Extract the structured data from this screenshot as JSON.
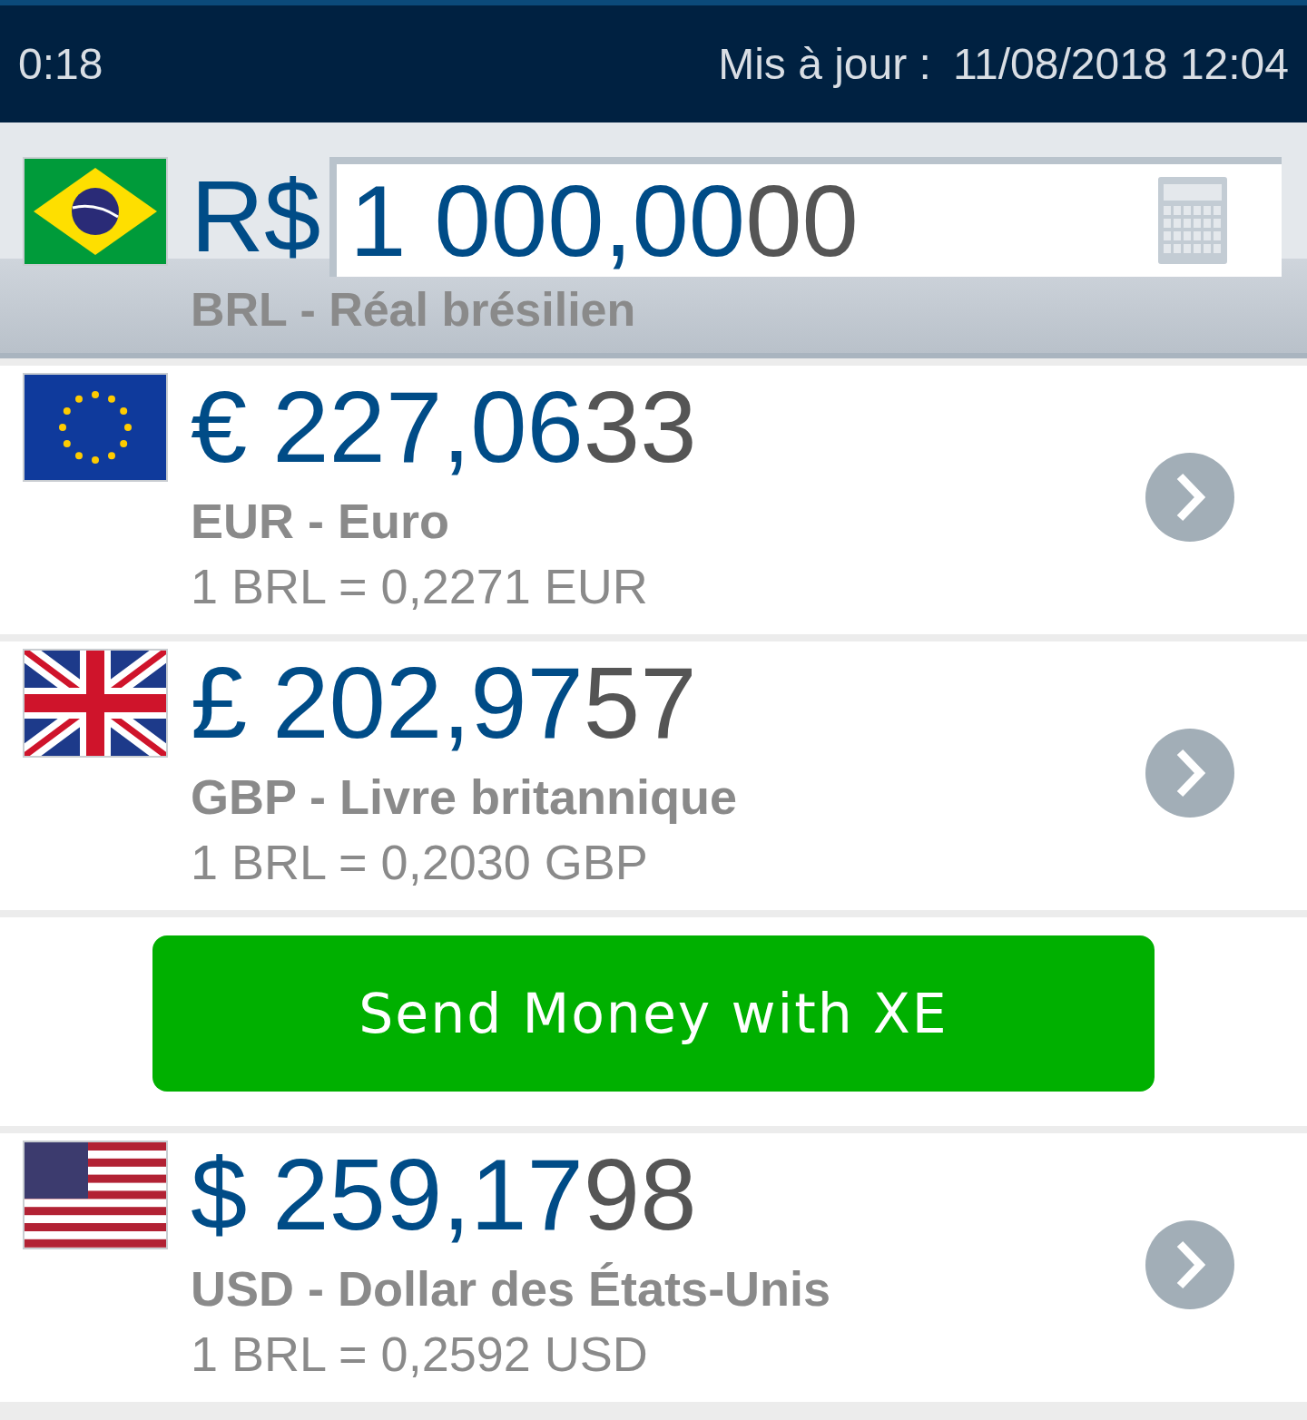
{
  "status_bar": {
    "time": "0:18",
    "updated_label": "Mis à jour :",
    "updated_value": "11/08/2018 12:04"
  },
  "base": {
    "flag": {
      "kind": "brazil"
    },
    "symbol": "R$",
    "amount_main": "1 000,00",
    "amount_tail": "00",
    "name": "BRL - Réal brésilien"
  },
  "rows": [
    {
      "kind": "currency",
      "flag": {
        "kind": "eu"
      },
      "symbol": "€",
      "amount_main": "227,06",
      "amount_tail": "33",
      "name": "EUR - Euro",
      "rate": "1 BRL = 0,2271 EUR"
    },
    {
      "kind": "currency",
      "flag": {
        "kind": "uk"
      },
      "symbol": "£",
      "amount_main": "202,97",
      "amount_tail": "57",
      "name": "GBP - Livre britannique",
      "rate": "1 BRL = 0,2030 GBP"
    },
    {
      "kind": "promo",
      "label": "Send Money with XE"
    },
    {
      "kind": "currency",
      "flag": {
        "kind": "us"
      },
      "symbol": "$",
      "amount_main": "259,17",
      "amount_tail": "98",
      "name": "USD - Dollar des États-Unis",
      "rate": "1 BRL = 0,2592 USD"
    }
  ]
}
